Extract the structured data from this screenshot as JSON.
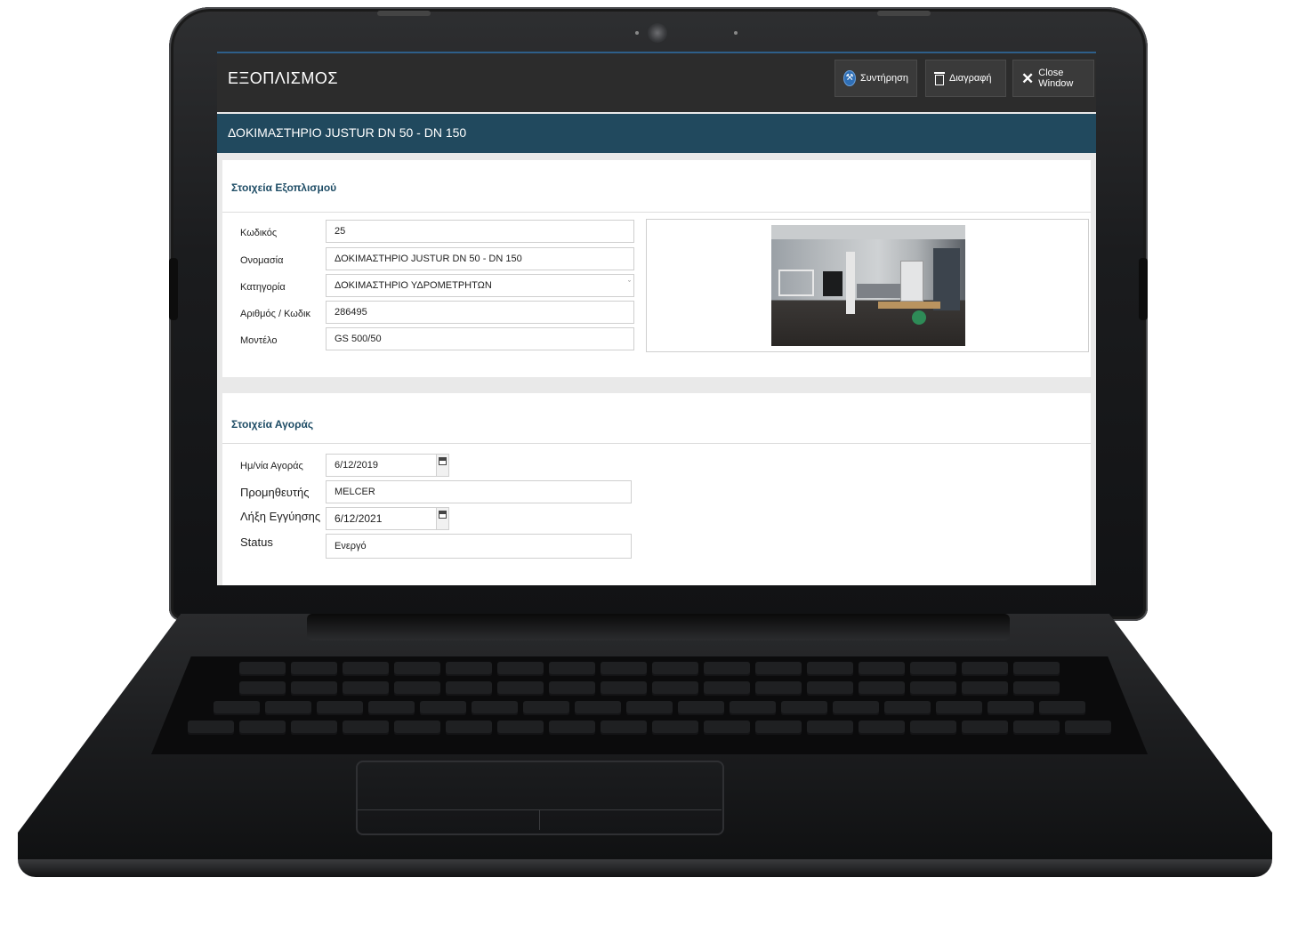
{
  "app": {
    "title": "ΕΞΟΠΛΙΣΜΟΣ",
    "toolbar": {
      "maintenance_label": "Συντήρηση",
      "delete_label": "Διαγραφή",
      "close_label": "Close Window"
    }
  },
  "record": {
    "title": "ΔΟΚΙΜΑΣΤΗΡΙΟ JUSTUR DN 50 - DN 150"
  },
  "equipment_section": {
    "heading": "Στοιχεία Εξοπλισμού",
    "fields": {
      "code": {
        "label": "Κωδικός",
        "value": "25"
      },
      "name": {
        "label": "Ονομασία",
        "value": "ΔΟΚΙΜΑΣΤΗΡΙΟ JUSTUR DN 50 - DN 150"
      },
      "category": {
        "label": "Κατηγορία",
        "value": "ΔΟΚΙΜΑΣΤΗΡΙΟ ΥΔΡΟΜΕΤΡΗΤΩΝ"
      },
      "serial": {
        "label": "Αριθμός / Κωδικ",
        "value": "286495"
      },
      "model": {
        "label": "Μοντέλο",
        "value": "GS 500/50"
      }
    }
  },
  "purchase_section": {
    "heading": "Στοιχεία Αγοράς",
    "fields": {
      "purchase_date": {
        "label": "Ημ/νία Αγοράς",
        "value": "6/12/2019"
      },
      "supplier": {
        "label": "Προμηθευτής",
        "value": "MELCER"
      },
      "warranty_end": {
        "label": "Λήξη Εγγύησης",
        "value": "6/12/2021"
      },
      "status": {
        "label": "Status",
        "value": "Ενεργό"
      }
    }
  },
  "icons": {
    "maintenance": "maintenance-icon",
    "delete": "trash-icon",
    "close": "close-icon",
    "calendar": "calendar-icon",
    "select": "chevron-down-icon"
  },
  "colors": {
    "appbar": "#2c2c2c",
    "record_bar": "#21495e",
    "section_heading": "#1f4d66",
    "accent_blue": "#2f6fb6"
  }
}
